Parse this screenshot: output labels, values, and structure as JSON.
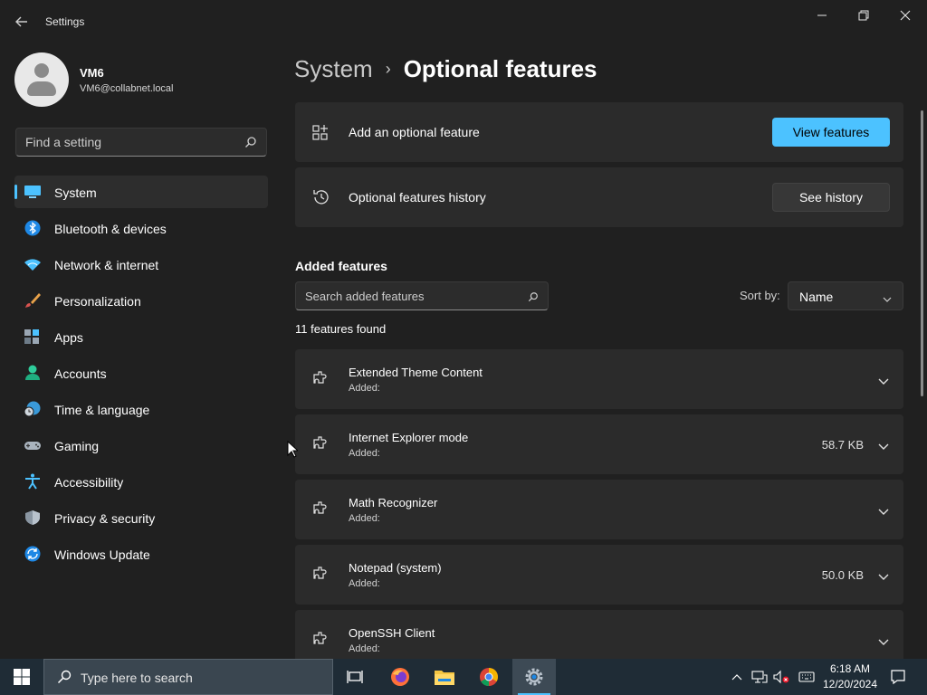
{
  "window": {
    "title": "Settings"
  },
  "profile": {
    "name": "VM6",
    "email": "VM6@collabnet.local"
  },
  "search": {
    "placeholder": "Find a setting"
  },
  "nav": {
    "items": [
      {
        "label": "System",
        "icon": "system-icon",
        "active": true
      },
      {
        "label": "Bluetooth & devices",
        "icon": "bluetooth-icon"
      },
      {
        "label": "Network & internet",
        "icon": "wifi-icon"
      },
      {
        "label": "Personalization",
        "icon": "brush-icon"
      },
      {
        "label": "Apps",
        "icon": "apps-icon"
      },
      {
        "label": "Accounts",
        "icon": "account-icon"
      },
      {
        "label": "Time & language",
        "icon": "globe-clock-icon"
      },
      {
        "label": "Gaming",
        "icon": "gamepad-icon"
      },
      {
        "label": "Accessibility",
        "icon": "accessibility-icon"
      },
      {
        "label": "Privacy & security",
        "icon": "shield-icon"
      },
      {
        "label": "Windows Update",
        "icon": "update-icon"
      }
    ]
  },
  "breadcrumb": {
    "parent": "System",
    "separator": "›",
    "current": "Optional features"
  },
  "add_card": {
    "label": "Add an optional feature",
    "button": "View features"
  },
  "history_card": {
    "label": "Optional features history",
    "button": "See history"
  },
  "added": {
    "title": "Added features",
    "search_placeholder": "Search added features",
    "sort_label": "Sort by:",
    "sort_value": "Name",
    "count": "11 features found",
    "features": [
      {
        "name": "Extended Theme Content",
        "status": "Added:",
        "size": ""
      },
      {
        "name": "Internet Explorer mode",
        "status": "Added:",
        "size": "58.7 KB"
      },
      {
        "name": "Math Recognizer",
        "status": "Added:",
        "size": ""
      },
      {
        "name": "Notepad (system)",
        "status": "Added:",
        "size": "50.0 KB"
      },
      {
        "name": "OpenSSH Client",
        "status": "Added:",
        "size": ""
      }
    ]
  },
  "taskbar": {
    "search_text": "Type here to search",
    "time": "6:18 AM",
    "date": "12/20/2024"
  },
  "colors": {
    "accent": "#4cc2ff",
    "background": "#202020",
    "card": "#2b2b2b",
    "taskbar": "#1f2c36"
  }
}
